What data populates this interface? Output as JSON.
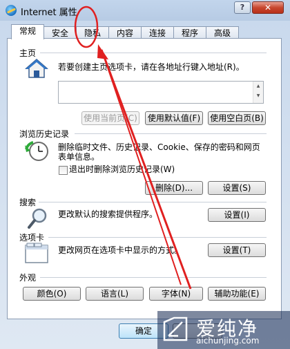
{
  "window": {
    "title": "Internet 属性",
    "help_label": "?",
    "close_label": "✕"
  },
  "tabs": [
    {
      "label": "常规",
      "active": true
    },
    {
      "label": "安全"
    },
    {
      "label": "隐私"
    },
    {
      "label": "内容"
    },
    {
      "label": "连接"
    },
    {
      "label": "程序"
    },
    {
      "label": "高级"
    }
  ],
  "homepage": {
    "heading": "主页",
    "description": "若要创建主页选项卡，请在各地址行键入地址(R)。",
    "url_value": "",
    "buttons": [
      "使用当前页(C)",
      "使用默认值(F)",
      "使用空白页(B)"
    ]
  },
  "history": {
    "heading": "浏览历史记录",
    "description_line1": "删除临时文件、历史记录、Cookie、保存的密码和网页",
    "description_line2": "表单信息。",
    "checkbox_label": "退出时删除浏览历史记录(W)",
    "checkbox_checked": false,
    "delete_button": "删除(D)...",
    "settings_button": "设置(S)"
  },
  "search": {
    "heading": "搜索",
    "description": "更改默认的搜索提供程序。",
    "settings_button": "设置(I)"
  },
  "tabs_section": {
    "heading": "选项卡",
    "description": "更改网页在选项卡中显示的方式。",
    "settings_button": "设置(T)"
  },
  "appearance": {
    "heading": "外观",
    "buttons": [
      "颜色(O)",
      "语言(L)",
      "字体(N)",
      "辅助功能(E)"
    ]
  },
  "footer": {
    "ok_label": "确定"
  },
  "watermark": {
    "text": "爱纯净",
    "url": "aichunjing.com"
  },
  "colors": {
    "annotation_red": "#e02020",
    "tab_border": "#8a9bb3"
  }
}
